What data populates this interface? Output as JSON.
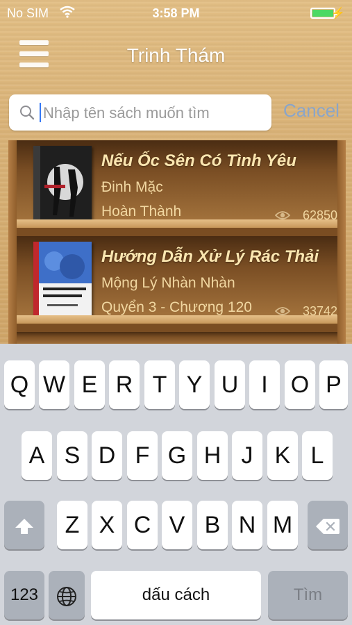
{
  "status_bar": {
    "carrier": "No SIM",
    "time": "3:58 PM",
    "battery_color": "#4cd964"
  },
  "nav": {
    "title": "Trinh Thám",
    "menu_icon": "hamburger-menu-icon"
  },
  "search": {
    "placeholder": "Nhập tên sách muốn tìm",
    "value": "",
    "cancel_label": "Cancel"
  },
  "books": [
    {
      "title": "Nếu Ốc Sên Có Tình Yêu",
      "author": "Đinh Mặc",
      "status": "Hoàn Thành",
      "views": "62850",
      "cover_color": "#2a2a2a"
    },
    {
      "title": "Hướng Dẫn Xử Lý Rác Thải",
      "author": "Mộng Lý Nhàn Nhàn",
      "status": "Quyển 3 - Chương 120",
      "views": "33742",
      "cover_color": "#3e6fc8"
    }
  ],
  "keyboard": {
    "row1": [
      "Q",
      "W",
      "E",
      "R",
      "T",
      "Y",
      "U",
      "I",
      "O",
      "P"
    ],
    "row2": [
      "A",
      "S",
      "D",
      "F",
      "G",
      "H",
      "J",
      "K",
      "L"
    ],
    "row3": [
      "Z",
      "X",
      "C",
      "V",
      "B",
      "N",
      "M"
    ],
    "numbers_label": "123",
    "space_label": "dấu cách",
    "return_label": "Tìm"
  }
}
